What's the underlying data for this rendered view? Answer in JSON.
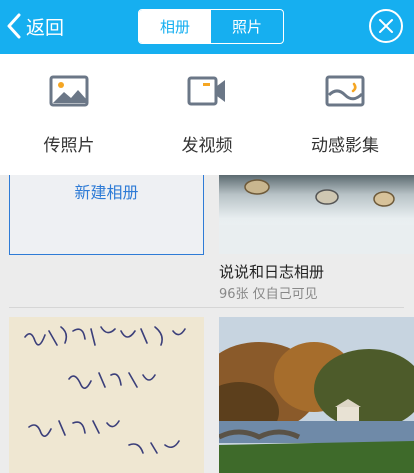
{
  "header": {
    "back_label": "返回",
    "tabs": [
      {
        "label": "相册",
        "active": true
      },
      {
        "label": "照片",
        "active": false
      }
    ]
  },
  "actions": [
    {
      "label": "传照片",
      "icon": "photo-icon"
    },
    {
      "label": "发视频",
      "icon": "video-camera-icon"
    },
    {
      "label": "动感影集",
      "icon": "slideshow-album-icon"
    }
  ],
  "albums": {
    "new_album_label": "新建相册",
    "items": [
      {
        "title": "说说和日志相册",
        "meta": "96张 仅自己可见"
      }
    ]
  },
  "colors": {
    "accent": "#16aff0",
    "icon_gray": "#6b7787",
    "icon_orange": "#f5a623",
    "link_blue": "#2e7bd6"
  }
}
